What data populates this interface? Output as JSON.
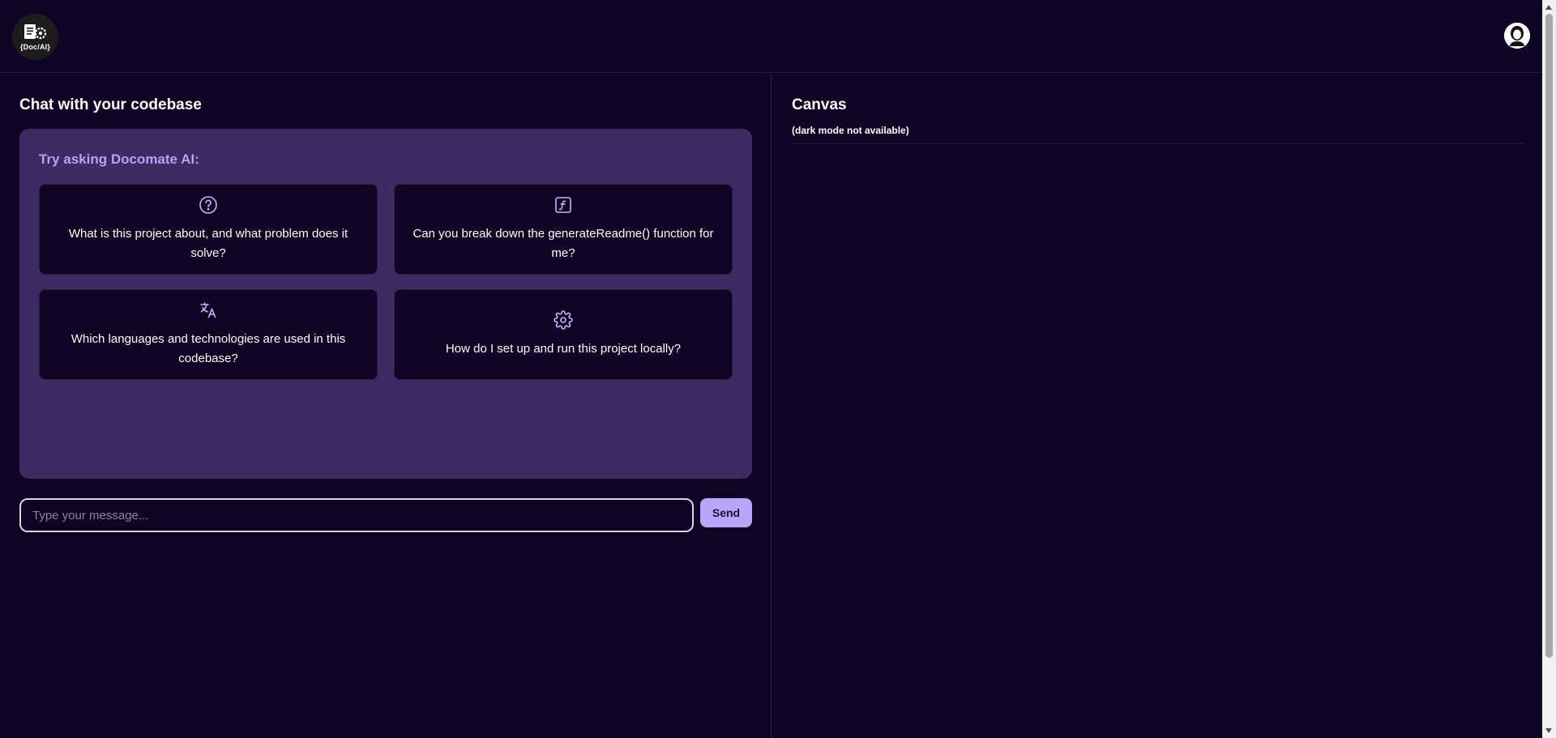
{
  "header": {
    "logo_text": "{Doc/AI}",
    "logo_icon": "doc-gear-icon",
    "avatar_icon": "user-avatar-icon"
  },
  "chat": {
    "title": "Chat with your codebase",
    "suggestions_heading": "Try asking Docomate AI:",
    "suggestions": [
      {
        "icon": "question-circle-icon",
        "text": "What is this project about, and what problem does it solve?"
      },
      {
        "icon": "function-icon",
        "text": "Can you break down the generateReadme() function for me?"
      },
      {
        "icon": "translate-icon",
        "text": "Which languages and technologies are used in this codebase?"
      },
      {
        "icon": "gear-icon",
        "text": "How do I set up and run this project locally?"
      }
    ],
    "input_placeholder": "Type your message...",
    "input_value": "",
    "send_label": "Send"
  },
  "canvas": {
    "title": "Canvas",
    "note": "(dark mode not available)"
  },
  "colors": {
    "background": "#0f0424",
    "suggest_box": "#3f2a64",
    "accent": "#b9a2f5",
    "send_button": "#b9a6f8"
  }
}
